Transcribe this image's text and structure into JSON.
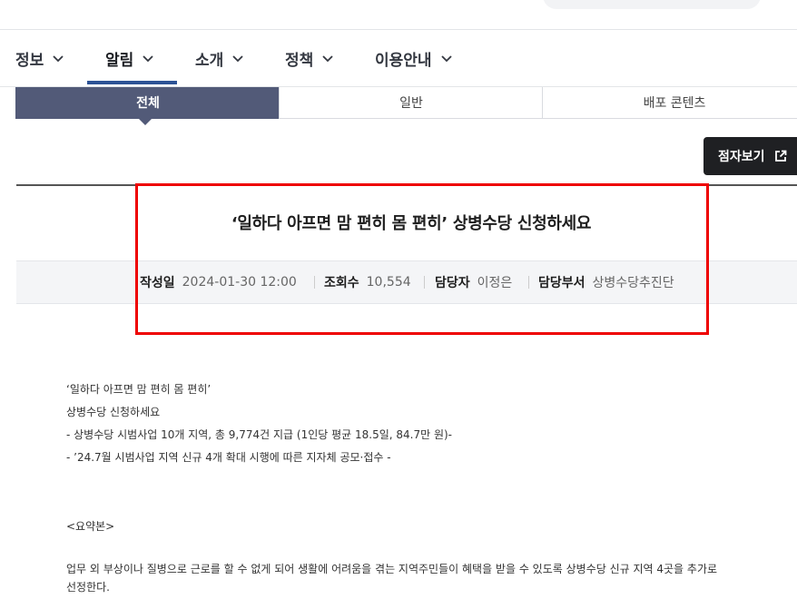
{
  "gnb": {
    "items": [
      {
        "label": "정보"
      },
      {
        "label": "알림"
      },
      {
        "label": "소개"
      },
      {
        "label": "정책"
      },
      {
        "label": "이용안내"
      }
    ],
    "active_index": 1
  },
  "tabs": [
    {
      "label": "전체"
    },
    {
      "label": "일반"
    },
    {
      "label": "배포 콘텐츠"
    }
  ],
  "braille_button": {
    "label": "점자보기"
  },
  "article": {
    "title": "‘일하다 아프면 맘 편히 몸 편히’ 상병수당 신청하세요",
    "meta": {
      "date_label": "작성일",
      "date_value": "2024-01-30 12:00",
      "views_label": "조회수",
      "views_value": "10,554",
      "manager_label": "담당자",
      "manager_value": "이정은",
      "dept_label": "담당부서",
      "dept_value": "상병수당추진단"
    },
    "body": [
      "‘일하다 아프면 맘 편히 몸 편히’",
      "상병수당 신청하세요",
      "- 상병수당 시범사업 10개 지역, 총 9,774건 지급 (1인당 평균 18.5일, 84.7만 원)-",
      "- ’24.7월 시범사업 지역 신규 4개 확대 시행에 따른 지자체 공모·접수 -",
      "<요약본>",
      "  업무 외 부상이나 질병으로 근로를 할 수 없게 되어 생활에 어려움을 겪는 지역주민들이 혜택을 받을 수 있도록 상병수당 신규 지역 4곳을 추가로",
      "선정한다."
    ]
  },
  "colors": {
    "active_tab": "#525a78",
    "nav_underline": "#2c5295",
    "highlight_box": "#ee0000",
    "braille_button": "#1f2023"
  },
  "icons": {
    "nav_chevron": "chevron-down-icon",
    "braille": "external-link-icon"
  }
}
